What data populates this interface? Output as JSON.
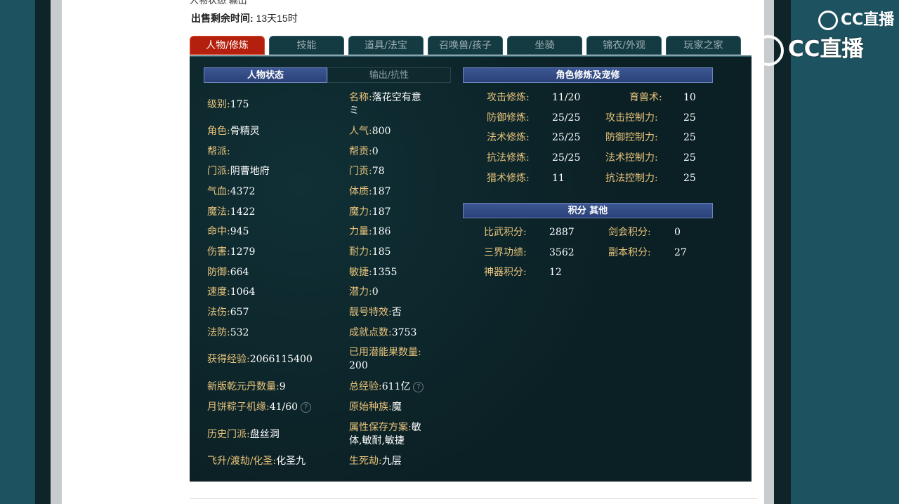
{
  "header": {
    "cut_text": "人物状态  输出",
    "sale_label": "出售剩余时间:",
    "sale_value": "13天15时"
  },
  "tabs": [
    {
      "label": "人物/修炼"
    },
    {
      "label": "技能"
    },
    {
      "label": "道具/法宝"
    },
    {
      "label": "召唤兽/孩子"
    },
    {
      "label": "坐骑"
    },
    {
      "label": "锦衣/外观"
    },
    {
      "label": "玩家之家"
    }
  ],
  "status": {
    "tab_active": "人物状态",
    "tab_inactive": "输出/抗性",
    "left": [
      {
        "k": "级别:",
        "v": "175"
      },
      {
        "k": "角色:",
        "v": "骨精灵"
      },
      {
        "k": "帮派:",
        "v": ""
      },
      {
        "k": "门派:",
        "v": "阴曹地府"
      },
      {
        "k": "气血:",
        "v": "4372"
      },
      {
        "k": "魔法:",
        "v": "1422"
      },
      {
        "k": "命中:",
        "v": "945"
      },
      {
        "k": "伤害:",
        "v": "1279"
      },
      {
        "k": "防御:",
        "v": "664"
      },
      {
        "k": "速度:",
        "v": "1064"
      },
      {
        "k": "法伤:",
        "v": "657"
      },
      {
        "k": "法防:",
        "v": "532"
      },
      {
        "k": "获得经验:",
        "v": "2066115400"
      },
      {
        "k": "新版乾元丹数量:",
        "v": "9"
      },
      {
        "k": "月饼粽子机缘:",
        "v": "41/60"
      },
      {
        "k": "历史门派:",
        "v": "盘丝洞"
      },
      {
        "k": "飞升/渡劫/化圣:",
        "v": "化圣九"
      }
    ],
    "right": [
      {
        "k": "名称:",
        "v": "落花空有意",
        "v2": "ミ"
      },
      {
        "k": "人气:",
        "v": "800"
      },
      {
        "k": "帮贡:",
        "v": "0"
      },
      {
        "k": "门贡:",
        "v": "78"
      },
      {
        "k": "体质:",
        "v": "187"
      },
      {
        "k": "魔力:",
        "v": "187"
      },
      {
        "k": "力量:",
        "v": "186"
      },
      {
        "k": "耐力:",
        "v": "185"
      },
      {
        "k": "敏捷:",
        "v": "1355"
      },
      {
        "k": "潜力:",
        "v": "0"
      },
      {
        "k": "靓号特效:",
        "v": "否"
      },
      {
        "k": "成就点数:",
        "v": "3753"
      },
      {
        "k": "已用潜能果数量:",
        "v": "200"
      },
      {
        "k": "总经验:",
        "v": "611亿"
      },
      {
        "k": "原始种族:",
        "v": "魔"
      },
      {
        "k": "属性保存方案:",
        "v": "敏",
        "v2": "体,敏耐,敏捷"
      },
      {
        "k": "生死劫:",
        "v": "九层"
      }
    ]
  },
  "cultivation": {
    "title": "角色修炼及宠修",
    "rows": [
      {
        "k1": "攻击修炼:",
        "v1": "11/20",
        "k2": "育兽术:",
        "v2": "10"
      },
      {
        "k1": "防御修炼:",
        "v1": "25/25",
        "k2": "攻击控制力:",
        "v2": "25"
      },
      {
        "k1": "法术修炼:",
        "v1": "25/25",
        "k2": "防御控制力:",
        "v2": "25"
      },
      {
        "k1": "抗法修炼:",
        "v1": "25/25",
        "k2": "法术控制力:",
        "v2": "25"
      },
      {
        "k1": "猎术修炼:",
        "v1": "11",
        "k2": "抗法控制力:",
        "v2": "25"
      }
    ]
  },
  "points": {
    "title": "积分 其他",
    "rows": [
      {
        "k1": "比武积分:",
        "v1": "2887",
        "k2": "剑会积分:",
        "v2": "0"
      },
      {
        "k1": "三界功绩:",
        "v1": "3562",
        "k2": "副本积分:",
        "v2": "27"
      },
      {
        "k1": "神器积分:",
        "v1": "12",
        "k2": "",
        "v2": ""
      }
    ]
  },
  "watermark": {
    "small": "CC直播",
    "big": "CC直播"
  },
  "help_glyph": "?"
}
